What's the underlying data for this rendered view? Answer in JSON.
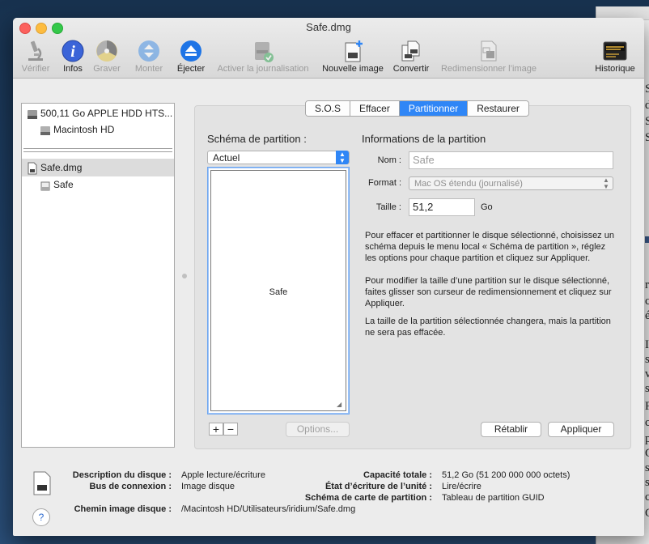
{
  "window": {
    "title": "Safe.dmg"
  },
  "toolbar": [
    {
      "label": "Vérifier",
      "icon": "microscope-icon",
      "enabled": false
    },
    {
      "label": "Infos",
      "icon": "info-icon",
      "enabled": true
    },
    {
      "label": "Graver",
      "icon": "burn-disc-icon",
      "enabled": false
    },
    {
      "label": "Monter",
      "icon": "mount-icon",
      "enabled": false
    },
    {
      "label": "Éjecter",
      "icon": "eject-icon",
      "enabled": true
    },
    {
      "label": "Activer la journalisation",
      "icon": "journal-disk-icon",
      "enabled": false
    },
    {
      "label": "Nouvelle image",
      "icon": "new-image-icon",
      "enabled": true
    },
    {
      "label": "Convertir",
      "icon": "convert-icon",
      "enabled": true
    },
    {
      "label": "Redimensionner l’image",
      "icon": "resize-image-icon",
      "enabled": false
    },
    {
      "label": "Historique",
      "icon": "log-console-icon",
      "enabled": true
    }
  ],
  "sidebar": {
    "items": [
      {
        "label": "500,11 Go APPLE HDD HTS..."
      },
      {
        "label": "Macintosh HD"
      },
      {
        "label": "Safe.dmg"
      },
      {
        "label": "Safe"
      }
    ]
  },
  "tabs": [
    "S.O.S",
    "Effacer",
    "Partitionner",
    "Restaurer"
  ],
  "active_tab": "Partitionner",
  "partition": {
    "schema_label": "Schéma de partition :",
    "schema_value": "Actuel",
    "map_partition": "Safe",
    "plus": "+",
    "minus": "−",
    "options_button": "Options..."
  },
  "info": {
    "heading": "Informations de la partition",
    "nom_label": "Nom :",
    "nom_value": "Safe",
    "format_label": "Format :",
    "format_value": "Mac OS étendu (journalisé)",
    "taille_label": "Taille :",
    "taille_value": "51,2",
    "taille_unit": "Go",
    "text1": "Pour effacer et partitionner le disque sélectionné, choisissez un schéma depuis le menu local « Schéma de partition », réglez les options pour chaque partition et cliquez sur Appliquer.",
    "text2": "Pour modifier la taille d’une partition sur le disque sélectionné, faites glisser son curseur de redimensionnement et cliquez sur Appliquer.",
    "text3": "La taille de la partition sélectionnée changera, mais la partition ne sera pas effacée.",
    "retablir": "Rétablir",
    "appliquer": "Appliquer"
  },
  "bottom": {
    "desc_k": "Description du disque :",
    "desc_v": "Apple lecture/écriture",
    "bus_k": "Bus de connexion :",
    "bus_v": "Image disque",
    "chemin_k": "Chemin image disque :",
    "chemin_v": "/Macintosh HD/Utilisateurs/iridium/Safe.dmg",
    "cap_k": "Capacité totale :",
    "cap_v": "51,2 Go (51 200 000 000 octets)",
    "etat_k": "État d’écriture de l’unité :",
    "etat_v": "Lire/écrire",
    "schema_k": "Schéma de carte de partition :",
    "schema_v": "Tableau de partition GUID",
    "help": "?"
  },
  "background_doc": {
    "letters": [
      "S",
      "d",
      "S",
      "S",
      "r",
      "c",
      "é",
      "I",
      "s",
      "v",
      "s",
      "F",
      "c",
      "p",
      "C",
      "s",
      "s",
      "c",
      "C"
    ]
  },
  "colors": {
    "accent": "#2f86f6",
    "close": "#fc615d",
    "minimize": "#fdbc40",
    "zoom": "#34c84a"
  }
}
